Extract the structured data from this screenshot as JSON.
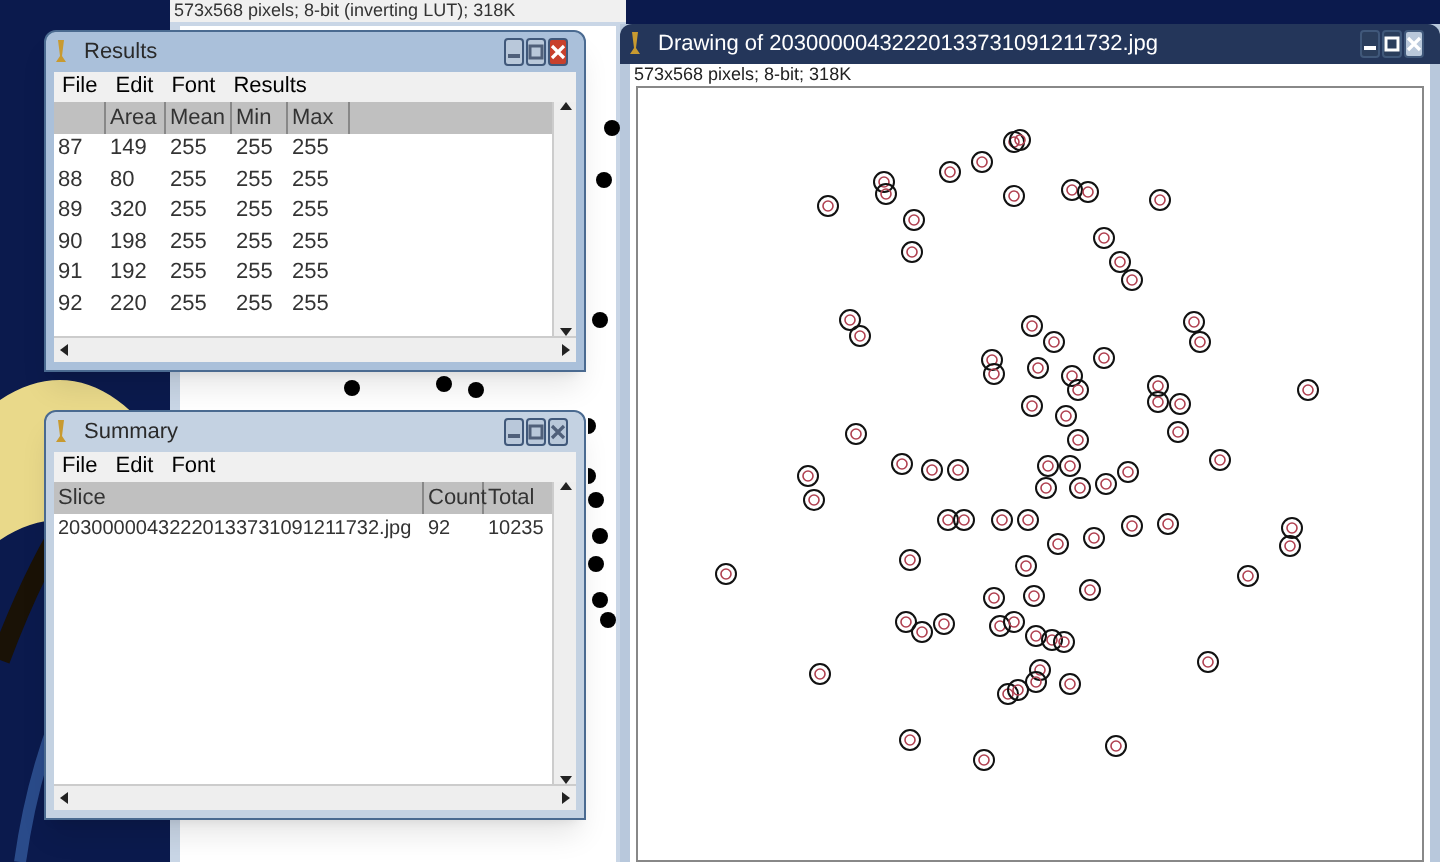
{
  "background_window": {
    "info": "573x568 pixels; 8-bit (inverting LUT); 318K"
  },
  "results_window": {
    "title": "Results",
    "active": true,
    "menu": [
      "File",
      "Edit",
      "Font",
      "Results"
    ],
    "columns": [
      "",
      "Area",
      "Mean",
      "Min",
      "Max"
    ],
    "rows": [
      [
        "87",
        "149",
        "255",
        "255",
        "255"
      ],
      [
        "88",
        "80",
        "255",
        "255",
        "255"
      ],
      [
        "89",
        "320",
        "255",
        "255",
        "255"
      ],
      [
        "90",
        "198",
        "255",
        "255",
        "255"
      ],
      [
        "91",
        "192",
        "255",
        "255",
        "255"
      ],
      [
        "92",
        "220",
        "255",
        "255",
        "255"
      ]
    ]
  },
  "summary_window": {
    "title": "Summary",
    "active": false,
    "menu": [
      "File",
      "Edit",
      "Font"
    ],
    "columns": [
      "Slice",
      "Count",
      "Total"
    ],
    "rows": [
      [
        "20300000432220133731091211732.jpg",
        "92",
        "10235"
      ]
    ]
  },
  "drawing_window": {
    "title": "Drawing of 20300000432220133731091211732.jpg",
    "info": "573x568 pixels; 8-bit; 318K"
  }
}
